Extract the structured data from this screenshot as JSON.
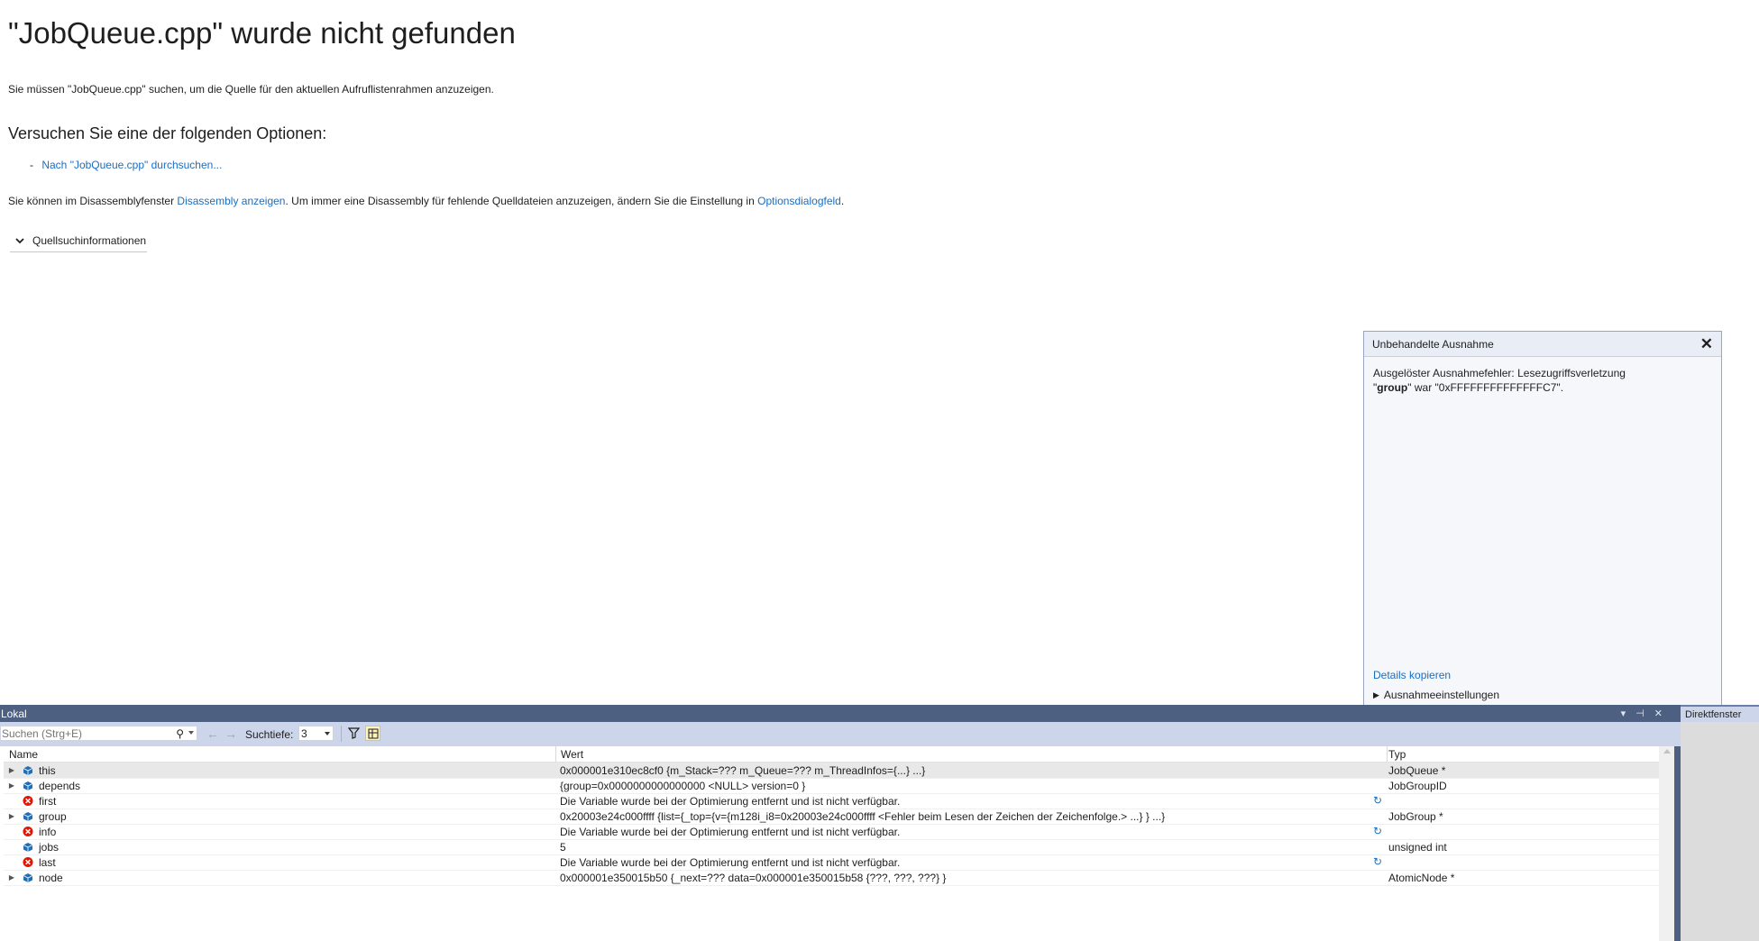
{
  "doc": {
    "title": "\"JobQueue.cpp\" wurde nicht gefunden",
    "intro": "Sie müssen \"JobQueue.cpp\" suchen, um die Quelle für den aktuellen Aufruflistenrahmen anzuzeigen.",
    "options_heading": "Versuchen Sie eine der folgenden Optionen:",
    "option_link": "Nach \"JobQueue.cpp\" durchsuchen...",
    "disasm_before": "Sie können im Disassemblyfenster ",
    "disasm_link": "Disassembly anzeigen",
    "disasm_middle": ". Um immer eine Disassembly für fehlende Quelldateien anzuzeigen, ändern Sie die Einstellung in ",
    "options_link": "Optionsdialogfeld",
    "disasm_after": ".",
    "expander_label": "Quellsuchinformationen"
  },
  "exception": {
    "title": "Unbehandelte Ausnahme",
    "message_line1": "Ausgelöster Ausnahmefehler: Lesezugriffsverletzung",
    "message_var": "group",
    "message_rest": " war \"0xFFFFFFFFFFFFFFC7\".",
    "details_link": "Details kopieren",
    "settings_label": "Ausnahmeeinstellungen"
  },
  "locals": {
    "title": "Lokal",
    "search_placeholder": "Suchen (Strg+E)",
    "depth_label": "Suchtiefe:",
    "depth_value": "3",
    "columns": {
      "name": "Name",
      "value": "Wert",
      "type": "Typ"
    },
    "rows": [
      {
        "name": "this",
        "value": "0x000001e310ec8cf0 {m_Stack=??? m_Queue=??? m_ThreadInfos={...} ...}",
        "type": "JobQueue *",
        "expandable": true,
        "kind": "var",
        "refresh": false
      },
      {
        "name": "depends",
        "value": "{group=0x0000000000000000 <NULL> version=0 }",
        "type": "JobGroupID",
        "expandable": true,
        "kind": "var",
        "refresh": false
      },
      {
        "name": "first",
        "value": "Die Variable wurde bei der Optimierung entfernt und ist nicht verfügbar.",
        "type": "",
        "expandable": false,
        "kind": "error",
        "refresh": true
      },
      {
        "name": "group",
        "value": "0x20003e24c000ffff {list={_top={v={m128i_i8=0x20003e24c000ffff <Fehler beim Lesen der Zeichen der Zeichenfolge.> ...} } ...}",
        "type": "JobGroup *",
        "expandable": true,
        "kind": "var",
        "refresh": false
      },
      {
        "name": "info",
        "value": "Die Variable wurde bei der Optimierung entfernt und ist nicht verfügbar.",
        "type": "",
        "expandable": false,
        "kind": "error",
        "refresh": true
      },
      {
        "name": "jobs",
        "value": "5",
        "type": "unsigned int",
        "expandable": false,
        "kind": "var",
        "refresh": false
      },
      {
        "name": "last",
        "value": "Die Variable wurde bei der Optimierung entfernt und ist nicht verfügbar.",
        "type": "",
        "expandable": false,
        "kind": "error",
        "refresh": true
      },
      {
        "name": "node",
        "value": "0x000001e350015b50 {_next=??? data=0x000001e350015b58 {???, ???, ???} }",
        "type": "AtomicNode *",
        "expandable": true,
        "kind": "var",
        "refresh": false
      }
    ]
  },
  "direct_window": {
    "title": "Direktfenster"
  },
  "colors": {
    "link": "#1a6ec2",
    "error": "#e51400",
    "title_bar": "#4d6082",
    "toolbar": "#ccd5ea"
  }
}
